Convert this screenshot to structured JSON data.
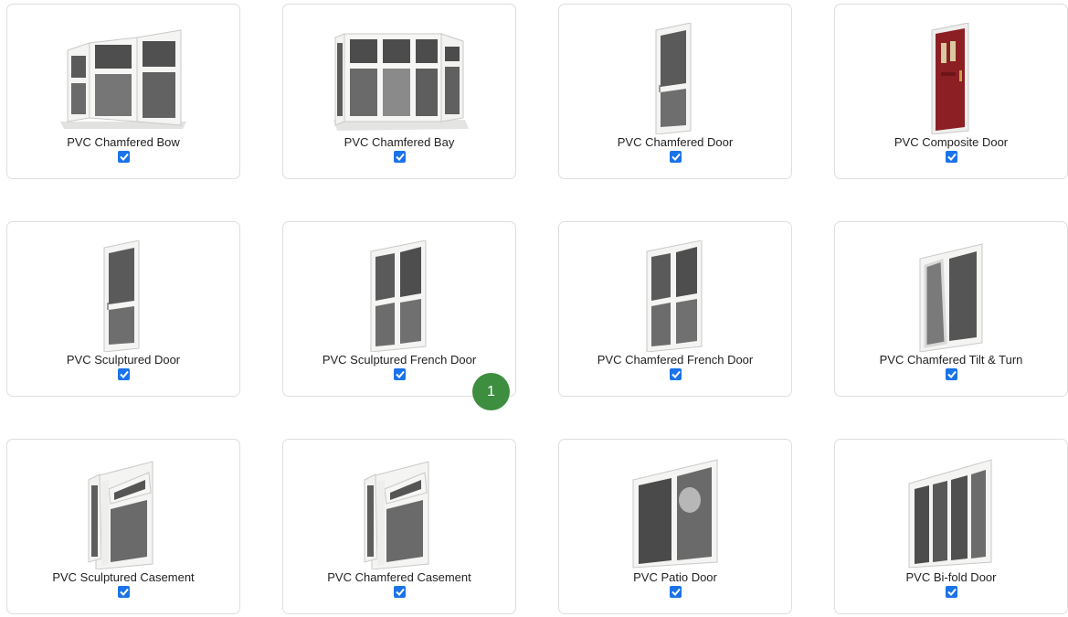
{
  "products": [
    {
      "label": "PVC Chamfered Bow",
      "icon": "bow-window-icon",
      "checked": true
    },
    {
      "label": "PVC Chamfered Bay",
      "icon": "bay-window-icon",
      "checked": true
    },
    {
      "label": "PVC Chamfered Door",
      "icon": "door-icon",
      "checked": true
    },
    {
      "label": "PVC Composite Door",
      "icon": "composite-door-icon",
      "checked": true
    },
    {
      "label": "PVC Sculptured Door",
      "icon": "door-icon",
      "checked": true
    },
    {
      "label": "PVC Sculptured French Door",
      "icon": "french-door-icon",
      "checked": true
    },
    {
      "label": "PVC Chamfered French Door",
      "icon": "french-door-icon",
      "checked": true
    },
    {
      "label": "PVC Chamfered Tilt & Turn",
      "icon": "tilt-turn-window-icon",
      "checked": true
    },
    {
      "label": "PVC Sculptured Casement",
      "icon": "casement-window-icon",
      "checked": true
    },
    {
      "label": "PVC Chamfered Casement",
      "icon": "casement-window-icon",
      "checked": true
    },
    {
      "label": "PVC Patio Door",
      "icon": "patio-door-icon",
      "checked": true
    },
    {
      "label": "PVC Bi-fold Door",
      "icon": "bifold-door-icon",
      "checked": true
    }
  ],
  "step_badge": {
    "label": "1"
  },
  "colors": {
    "checkbox": "#1a73e8",
    "badge": "#3d8e3f",
    "composite_door": "#8b1f24",
    "frame": "#f4f4f2",
    "glass": "#5a5a5a"
  }
}
